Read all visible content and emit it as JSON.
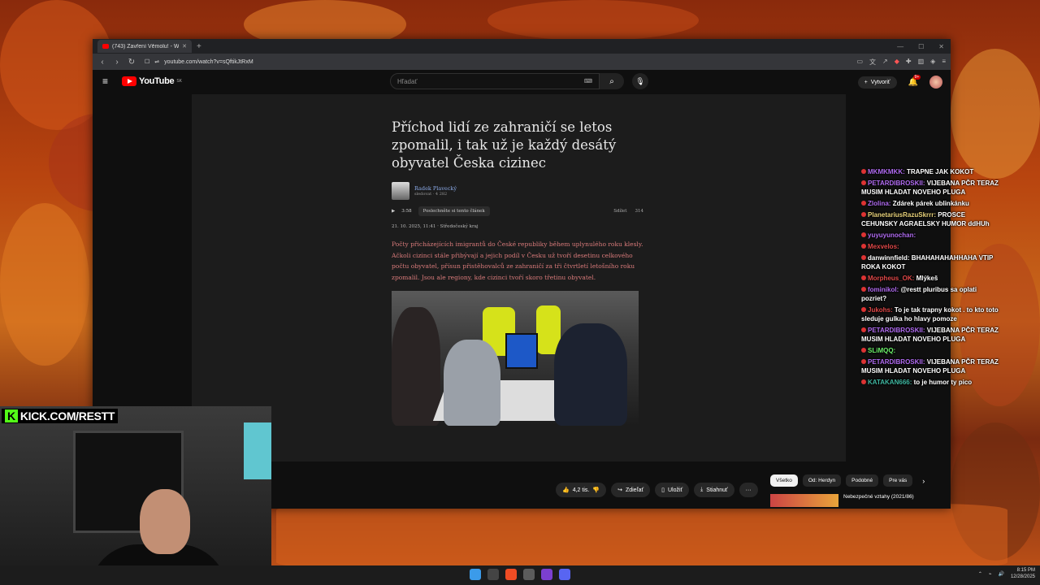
{
  "browser": {
    "tab_title": "(743) Zavření Věmolu! - Wolv",
    "url": "youtube.com/watch?v=sQftikJtRxM",
    "new_tab": "+"
  },
  "youtube": {
    "logo_word": "YouTube",
    "region": "SK",
    "search_placeholder": "Hľadať",
    "create_label": "Vytvoriť",
    "notif_count": "9+"
  },
  "article": {
    "title": "Příchod lidí ze zahraničí se letos zpomalil, i tak už je každý desátý obyvatel Česka cizinec",
    "author": "Radek Plavecký",
    "author_meta": "sledovat · 4 282",
    "listen_time": "3:58",
    "listen_label": "Poslechněte si tento článek",
    "share_label": "Sdílet",
    "comments": "314",
    "date_line": "21. 10. 2025, 11:41 · Středočeský kraj",
    "perex": "Počty přicházejících imigrantů do České republiky během uplynulého roku klesly. Ačkoli cizinci stále přibývají a jejich podíl v Česku už tvoří desetinu celkového počtu obyvatel, přísun přistěhovalců ze zahraničí za tři čtvrtletí letošního roku zpomalil. Jsou ale regiony, kde cizinci tvoří skoro třetinu obyvatel."
  },
  "chat": [
    {
      "user": "MKMKMKK:",
      "text": "TRAPNE JAK KOKOT",
      "color": "#b06bf0"
    },
    {
      "user": "PETARDIBROSKII:",
      "text": "VIJEBANA PČR TERAZ MUSIM HLADAT NOVEHO PLUGA",
      "color": "#b06bf0"
    },
    {
      "user": "Zlolina:",
      "text": "Zdárek párek ublinkánku",
      "color": "#b06bf0"
    },
    {
      "user": "PlanetariusRazuSkrrr:",
      "text": "PROSCE CEHUNSKY AGRAELSKY HUMOR ddHUh",
      "color": "#e9d27a"
    },
    {
      "user": "yuyuyunochan:",
      "text": "",
      "color": "#b06bf0"
    },
    {
      "user": "Mexvelos:",
      "text": "",
      "color": "#e04848"
    },
    {
      "user": "danwinnfield:",
      "text": "BHAHAHAHAHHAHA VTIP ROKA KOKOT",
      "color": "#ffffff"
    },
    {
      "user": "Morpheus_OK:",
      "text": "Mlýkeš",
      "color": "#e04848"
    },
    {
      "user": "fominikol:",
      "text": "@restt pluribus sa oplati pozriet?",
      "color": "#b06bf0"
    },
    {
      "user": "Jukohs:",
      "text": "To je tak trapny kokot . to kto toto sleduje gulka ho hlavy pomoze",
      "color": "#e04848"
    },
    {
      "user": "PETARDIBROSKII:",
      "text": "VIJEBANA PČR TERAZ MUSIM HLADAT NOVEHO PLUGA",
      "color": "#b06bf0"
    },
    {
      "user": "SLiMQQ:",
      "text": "",
      "color": "#6cf26a"
    },
    {
      "user": "PETARDIBROSKII:",
      "text": "VIJEBANA PČR TERAZ MUSIM HLADAT NOVEHO PLUGA",
      "color": "#b06bf0"
    },
    {
      "user": "KATAKAN666:",
      "text": "to je humor ty pico",
      "color": "#3fb6a0"
    }
  ],
  "actions": {
    "likes": "4,2 tis.",
    "share": "Zdieľať",
    "save": "Uložiť",
    "download": "Stiahnuť",
    "more": "···"
  },
  "chips": [
    "Všetko",
    "Od: Herdyn",
    "Podobné",
    "Pre vás"
  ],
  "recommendation": {
    "title": "Nebezpečné vztahy (2021/86)"
  },
  "stream": {
    "kick_label": "KICK.COM/RESTT"
  },
  "taskbar": {
    "time": "8:15 PM",
    "date": "12/28/2025"
  }
}
